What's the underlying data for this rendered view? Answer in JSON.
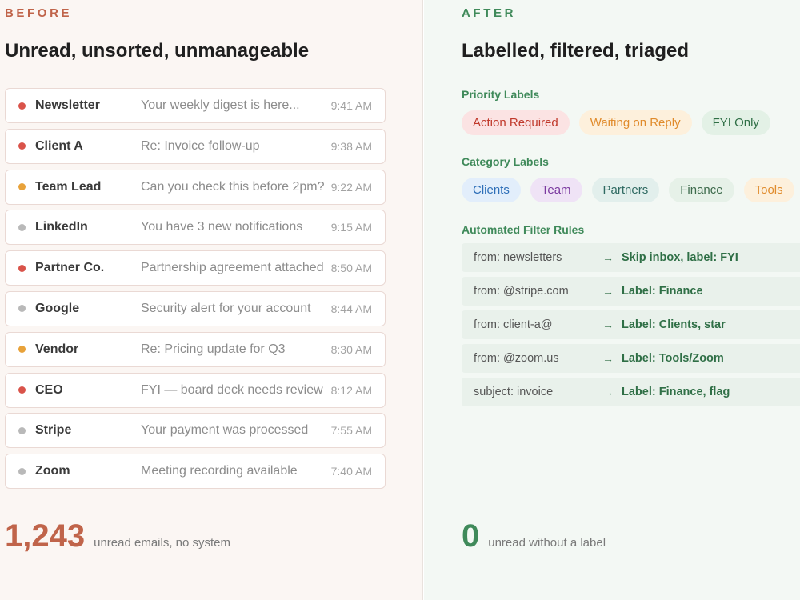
{
  "before": {
    "eyebrow": "BEFORE",
    "heading": "Unread, unsorted, unmanageable",
    "emails": [
      {
        "sender": "Newsletter",
        "subject": "Your weekly digest is here...",
        "time": "9:41 AM",
        "dot_color": "#d9534a"
      },
      {
        "sender": "Client A",
        "subject": "Re: Invoice follow-up",
        "time": "9:38 AM",
        "dot_color": "#d9534a"
      },
      {
        "sender": "Team Lead",
        "subject": "Can you check this before 2pm?",
        "time": "9:22 AM",
        "dot_color": "#e8a23a"
      },
      {
        "sender": "LinkedIn",
        "subject": "You have 3 new notifications",
        "time": "9:15 AM",
        "dot_color": "#b9b9b9"
      },
      {
        "sender": "Partner Co.",
        "subject": "Partnership agreement attached",
        "time": "8:50 AM",
        "dot_color": "#d9534a"
      },
      {
        "sender": "Google",
        "subject": "Security alert for your account",
        "time": "8:44 AM",
        "dot_color": "#b9b9b9"
      },
      {
        "sender": "Vendor",
        "subject": "Re: Pricing update for Q3",
        "time": "8:30 AM",
        "dot_color": "#e8a23a"
      },
      {
        "sender": "CEO",
        "subject": "FYI — board deck needs review",
        "time": "8:12 AM",
        "dot_color": "#d9534a"
      },
      {
        "sender": "Stripe",
        "subject": "Your payment was processed",
        "time": "7:55 AM",
        "dot_color": "#b9b9b9"
      },
      {
        "sender": "Zoom",
        "subject": "Meeting recording available",
        "time": "7:40 AM",
        "dot_color": "#b9b9b9"
      }
    ],
    "stat_value": "1,243",
    "stat_label": "unread emails, no system"
  },
  "after": {
    "eyebrow": "AFTER",
    "heading": "Labelled, filtered, triaged",
    "priority_title": "Priority Labels",
    "priority_labels": [
      {
        "label": "Action Required",
        "bg": "#fbe3e3",
        "fg": "#c0392b"
      },
      {
        "label": "Waiting on Reply",
        "bg": "#fdf0dc",
        "fg": "#e08b2c"
      },
      {
        "label": "FYI Only",
        "bg": "#e3f1e6",
        "fg": "#2f6f46"
      }
    ],
    "category_title": "Category Labels",
    "category_labels": [
      {
        "label": "Clients",
        "bg": "#e2eefb",
        "fg": "#2e6fb8"
      },
      {
        "label": "Team",
        "bg": "#efe3f6",
        "fg": "#7b3aa0"
      },
      {
        "label": "Partners",
        "bg": "#e2efec",
        "fg": "#2f6a62"
      },
      {
        "label": "Finance",
        "bg": "#e6f1e8",
        "fg": "#3d6b4c"
      },
      {
        "label": "Tools",
        "bg": "#fdf0dc",
        "fg": "#e08b2c"
      }
    ],
    "rules_title": "Automated Filter Rules",
    "rules": [
      {
        "from": "from: newsletters",
        "arrow": "→",
        "action": "Skip inbox, label: FYI"
      },
      {
        "from": "from: @stripe.com",
        "arrow": "→",
        "action": "Label: Finance"
      },
      {
        "from": "from: client-a@",
        "arrow": "→",
        "action": "Label: Clients, star"
      },
      {
        "from": "from: @zoom.us",
        "arrow": "→",
        "action": "Label: Tools/Zoom"
      },
      {
        "from": "subject: invoice",
        "arrow": "→",
        "action": "Label: Finance, flag"
      }
    ],
    "stat_value": "0",
    "stat_label": "unread without a label"
  }
}
